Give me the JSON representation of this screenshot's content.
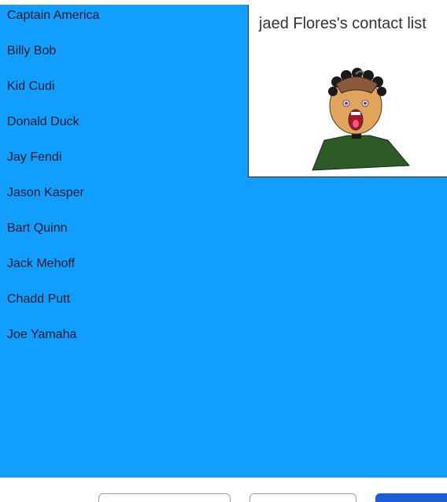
{
  "contacts": [
    "Captain America",
    "Billy Bob",
    "Kid Cudi",
    "Donald Duck",
    "Jay Fendi",
    "Jason Kasper",
    "Bart Quinn",
    "Jack Mehoff",
    "Chadd Putt",
    "Joe Yamaha"
  ],
  "card": {
    "title": "jaed Flores's contact list"
  },
  "footer": {
    "buttons": [
      "",
      "",
      ""
    ]
  },
  "colors": {
    "panel_bg": "#129efd",
    "primary_button": "#1a5fd6",
    "shirt": "#2d5a27",
    "skin": "#e0a45c"
  }
}
